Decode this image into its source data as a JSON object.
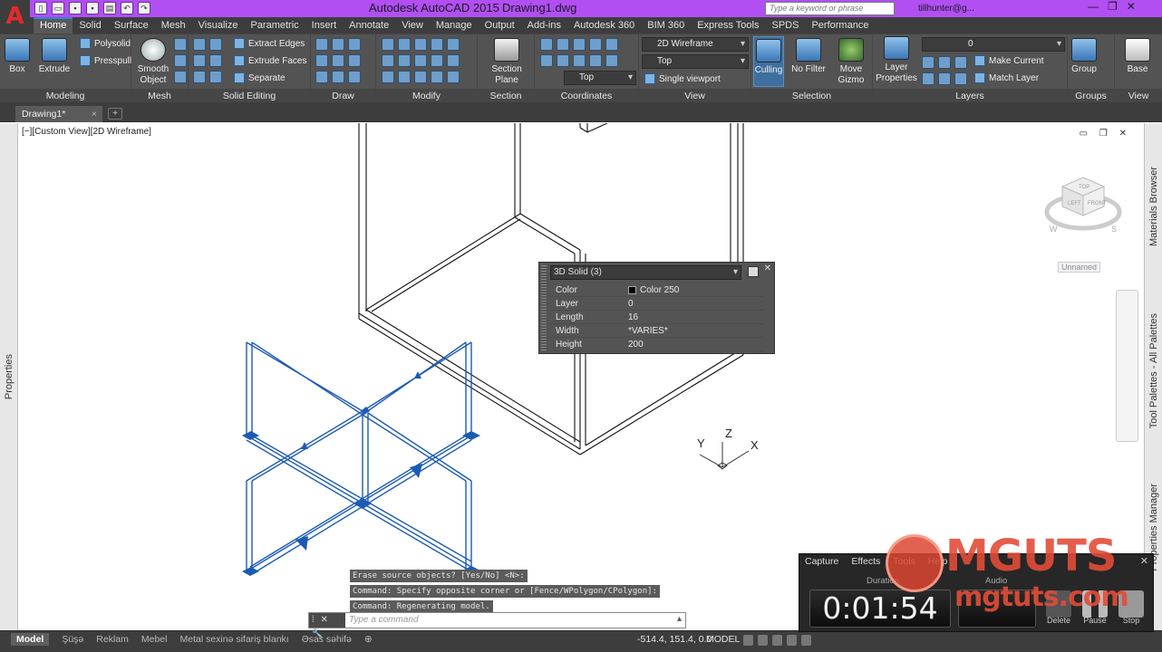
{
  "titlebar": {
    "app_title": "Autodesk AutoCAD 2015",
    "doc_title": "Drawing1.dwg",
    "search_placeholder": "Type a keyword or phrase",
    "user": "tillhunter@g...",
    "app_button": "A"
  },
  "ribbon_tabs": [
    "Home",
    "Solid",
    "Surface",
    "Mesh",
    "Visualize",
    "Parametric",
    "Insert",
    "Annotate",
    "View",
    "Manage",
    "Output",
    "Add-ins",
    "Autodesk 360",
    "BIM 360",
    "Express Tools",
    "SPDS",
    "Performance"
  ],
  "ribbon": {
    "modeling": {
      "title": "Modeling",
      "box": "Box",
      "extrude": "Extrude",
      "polysolid": "Polysolid",
      "presspull": "Presspull"
    },
    "mesh": {
      "title": "Mesh",
      "smooth_object_1": "Smooth",
      "smooth_object_2": "Object"
    },
    "solid_editing": {
      "title": "Solid Editing",
      "extract_edges": "Extract Edges",
      "extrude_faces": "Extrude Faces",
      "separate": "Separate"
    },
    "draw": {
      "title": "Draw"
    },
    "modify": {
      "title": "Modify"
    },
    "section": {
      "title": "Section",
      "section_plane_1": "Section",
      "section_plane_2": "Plane"
    },
    "coordinates": {
      "title": "Coordinates"
    },
    "view": {
      "title": "View",
      "visual_style": "2D Wireframe",
      "view_name": "Top",
      "coord_view": "Top",
      "viewport": "Single viewport"
    },
    "selection": {
      "title": "Selection",
      "culling": "Culling",
      "no_filter": "No Filter",
      "move_gizmo_1": "Move",
      "move_gizmo_2": "Gizmo"
    },
    "layers": {
      "title": "Layers",
      "layer_properties_1": "Layer",
      "layer_properties_2": "Properties",
      "current_layer": "0",
      "make_current": "Make Current",
      "match_layer": "Match Layer"
    },
    "groups": {
      "title": "Groups",
      "group": "Group"
    },
    "view2": {
      "title": "View",
      "base": "Base"
    }
  },
  "file_tabs": {
    "active": "Drawing1*",
    "close": "×",
    "new": "+"
  },
  "viewport": {
    "label": "[−][Custom View][2D Wireframe]",
    "controls": "▭ ❐ ✕",
    "unnamed": "Unnamed"
  },
  "side_palettes": {
    "left": "Properties",
    "right_top": "Materials Browser",
    "right_mid": "Tool Palettes - All Palettes",
    "right_bottom": "Properties Manager"
  },
  "quick_properties": {
    "object": "3D Solid (3)",
    "rows": [
      {
        "key": "Color",
        "value": "Color 250"
      },
      {
        "key": "Layer",
        "value": "0"
      },
      {
        "key": "Length",
        "value": "16"
      },
      {
        "key": "Width",
        "value": "*VARIES*"
      },
      {
        "key": "Height",
        "value": "200"
      }
    ]
  },
  "ucs": {
    "x": "X",
    "y": "Y",
    "z": "Z"
  },
  "command": {
    "history": [
      "Erase source objects? [Yes/No] <N>:",
      "Command: Specify opposite corner or [Fence/WPolygon/CPolygon]:",
      "Command:  Regenerating model."
    ],
    "placeholder": "Type a command",
    "tools": "⁞ ✕ 🔧"
  },
  "layout_tabs": [
    "Model",
    "Şüşə",
    "Reklam",
    "Mebel",
    "Metal sexinə sifariş blankı",
    "Əsas səhifə"
  ],
  "status": {
    "coords": "-514.4, 151.4, 0.0",
    "model": "MODEL"
  },
  "recorder": {
    "tabs": [
      "Capture",
      "Effects",
      "Tools",
      "Help"
    ],
    "close": "✕",
    "duration_label": "Duration",
    "timer": "0:01:54",
    "audio_label": "Audio",
    "delete": "Delete",
    "pause": "Pause",
    "stop": "Stop"
  },
  "watermark": {
    "brand": "MGUTS",
    "url": "mgtuts.com"
  },
  "colors": {
    "titlebar": "#b14ff2",
    "ribbon": "#535353",
    "selection_blue": "#1c5bb4",
    "recorder_bg": "#272727",
    "watermark": "#e24c38"
  }
}
